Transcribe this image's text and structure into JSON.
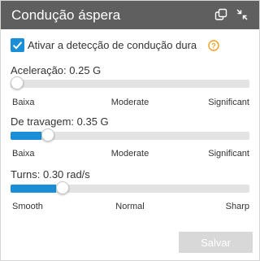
{
  "header": {
    "title": "Condução áspera",
    "background": "#5f5f5f",
    "icons": [
      "layers-icon",
      "collapse-icon"
    ]
  },
  "toggle": {
    "label": "Ativar a detecção de condução dura",
    "checked": true,
    "help_icon": "question-icon",
    "accent": "#1a8fd8"
  },
  "sliders": [
    {
      "label": "Aceleração: 0.25 G",
      "fraction": 0.0,
      "ticks": [
        "Baixa",
        "Moderate",
        "Significant"
      ]
    },
    {
      "label": "De travagem: 0.35 G",
      "fraction": 0.13,
      "ticks": [
        "Baixa",
        "Moderate",
        "Significant"
      ]
    },
    {
      "label": "Turns: 0.30 rad/s",
      "fraction": 0.19,
      "ticks": [
        "Smooth",
        "Normal",
        "Sharp"
      ]
    }
  ],
  "save_button": {
    "label": "Salvar",
    "enabled": false
  }
}
